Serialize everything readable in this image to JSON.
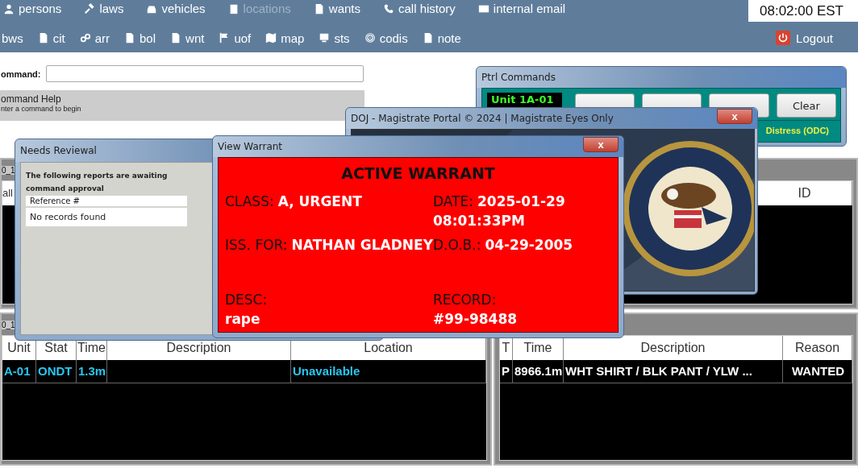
{
  "nav": {
    "primary": [
      {
        "label": "persons",
        "disabled": false
      },
      {
        "label": "laws",
        "disabled": false
      },
      {
        "label": "vehicles",
        "disabled": false
      },
      {
        "label": "locations",
        "disabled": true
      },
      {
        "label": "wants",
        "disabled": false
      },
      {
        "label": "call history",
        "disabled": false
      },
      {
        "label": "internal email",
        "disabled": false
      }
    ],
    "secondary": [
      "bws",
      "cit",
      "arr",
      "bol",
      "wnt",
      "uof",
      "map",
      "sts",
      "codis",
      "note"
    ],
    "clock": "08:02:00 EST",
    "logout": "Logout"
  },
  "command": {
    "label": "ommand:"
  },
  "help": {
    "title": "ommand Help",
    "hint": "nter a command to begin"
  },
  "panels": [
    {
      "title": "0_1",
      "columns": [
        "all"
      ]
    },
    {
      "columns": [
        "ID"
      ]
    },
    {
      "title": "0_1",
      "kind": "units",
      "columns": [
        "Unit",
        "Stat",
        "Time",
        "Description",
        "Location"
      ],
      "rows": [
        [
          "A-01",
          "ONDT",
          "1.3m",
          null,
          "Unavailable"
        ]
      ]
    },
    {
      "kind": "alerts",
      "columns": [
        "T",
        "Time",
        "Description",
        "Reason"
      ],
      "rows": [
        [
          "P",
          "8966.1m",
          "WHT SHIRT / BLK PANT / YLW ...",
          "WANTED"
        ]
      ]
    }
  ],
  "ptrl": {
    "title": "Ptrl Commands",
    "unit": "Unit 1A-01",
    "buttons": [
      {
        "kind": "covered"
      },
      {
        "kind": "covered"
      },
      {
        "kind": "covered"
      },
      {
        "kind": "labeled",
        "label": "Clear"
      }
    ],
    "status": "Distress (ODC)"
  },
  "doj": {
    "title": "DOJ - Magistrate Portal © 2024 | Magistrate Eyes Only",
    "close": "x"
  },
  "needs": {
    "title": "Needs Reviewal",
    "message": "The following reports are awaiting command approval",
    "column": "Reference #",
    "empty": "No records found"
  },
  "warrant": {
    "title": "View Warrant",
    "close": "x",
    "heading": "ACTIVE WARRANT",
    "fields": [
      {
        "kind": "inline",
        "label": "CLASS:",
        "value": "A, URGENT"
      },
      {
        "kind": "inline",
        "label": "DATE:",
        "value": "2025-01-29 08:01:33PM"
      },
      {
        "kind": "inline",
        "label": "ISS. FOR:",
        "value": "NATHAN GLADNEY"
      },
      {
        "kind": "inline",
        "label": "D.O.B.:",
        "value": "04-29-2005"
      },
      {
        "kind": "stacked",
        "label": "DESC:",
        "value": "rape"
      },
      {
        "kind": "stacked",
        "label": "RECORD:",
        "value": "#99-98488"
      }
    ]
  }
}
